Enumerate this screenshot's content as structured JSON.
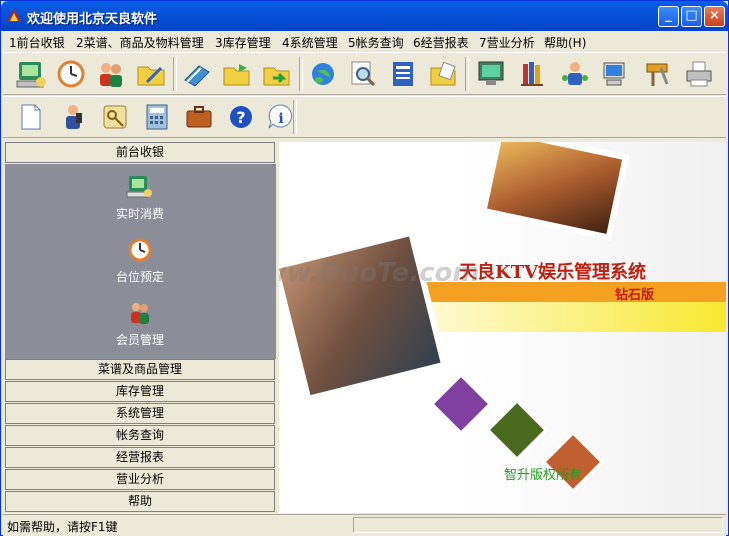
{
  "window": {
    "title": "欢迎使用北京天良软件",
    "buttons": {
      "minimize": "_",
      "maximize": "□",
      "close": "×"
    }
  },
  "menu": [
    "1前台收银",
    "2菜谱、商品及物料管理",
    "3库存管理",
    "4系统管理",
    "5帐务查询",
    "6经营报表",
    "7营业分析",
    "帮助(H)"
  ],
  "toolbar_row1_icons": [
    "pos-terminal-icon",
    "clock-icon",
    "members-icon",
    "folder-edit-icon",
    "book-icon",
    "folder-open-icon",
    "folder-arrow-icon",
    "globe-icon",
    "magnify-icon",
    "document-icon",
    "clipboard-edit-icon",
    "monitor-icon",
    "books-icon",
    "user-network-icon",
    "computer-icon",
    "tools-icon",
    "printer-icon"
  ],
  "toolbar_row2_icons": [
    "new-document-icon",
    "user-phone-icon",
    "key-icon",
    "calculator-icon",
    "briefcase-icon",
    "help-icon",
    "info-icon"
  ],
  "left_panel": {
    "active_category": "前台收银",
    "items": [
      {
        "label": "实时消费",
        "icon": "pos-terminal-icon"
      },
      {
        "label": "台位预定",
        "icon": "clock-icon"
      },
      {
        "label": "会员管理",
        "icon": "members-icon"
      }
    ],
    "categories": [
      "菜谱及商品管理",
      "库存管理",
      "系统管理",
      "帐务查询",
      "经营报表",
      "营业分析",
      "帮助"
    ]
  },
  "splash": {
    "product_title": "天良KTV娱乐管理系统",
    "edition": "钻石版",
    "footer_text": "智升版权所有",
    "watermark": "www.DuoTe.com"
  },
  "status": {
    "hint": "如需帮助，请按F1键"
  },
  "colors": {
    "titlebar": "#0553d8",
    "nav_body": "#8b8d98",
    "splash_orange": "#f5a020",
    "splash_yellow": "#f8e830"
  }
}
